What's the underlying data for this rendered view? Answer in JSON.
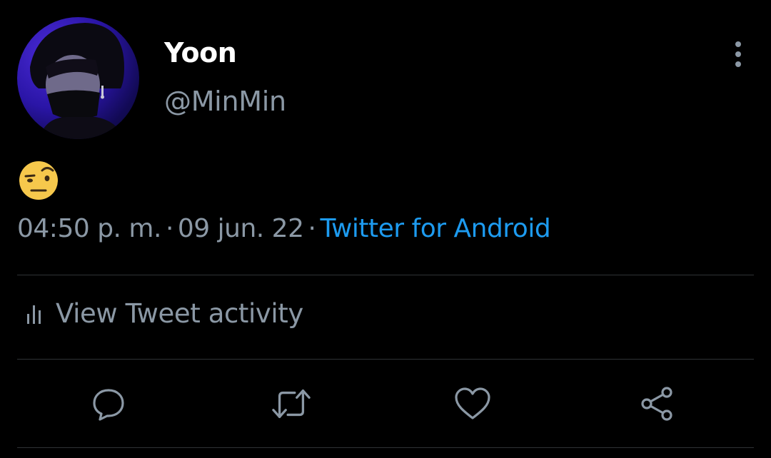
{
  "tweet": {
    "author_name": "Yoon",
    "author_handle": "@MinMin",
    "body_emoji": "face-with-raised-eyebrow",
    "time": "04:50 p. m.",
    "date": "09 jun. 22",
    "separator": "·",
    "source": "Twitter for Android"
  },
  "activity": {
    "label": "View Tweet activity",
    "icon": "bar-chart-icon"
  },
  "actions": [
    {
      "name": "reply",
      "icon": "speech-bubble-icon"
    },
    {
      "name": "retweet",
      "icon": "retweet-icon"
    },
    {
      "name": "like",
      "icon": "heart-icon"
    },
    {
      "name": "share",
      "icon": "share-icon"
    }
  ],
  "colors": {
    "background": "#000000",
    "primary_text": "#ffffff",
    "secondary_text": "#8b98a5",
    "link": "#1d9bf0",
    "divider": "#2f3336"
  }
}
